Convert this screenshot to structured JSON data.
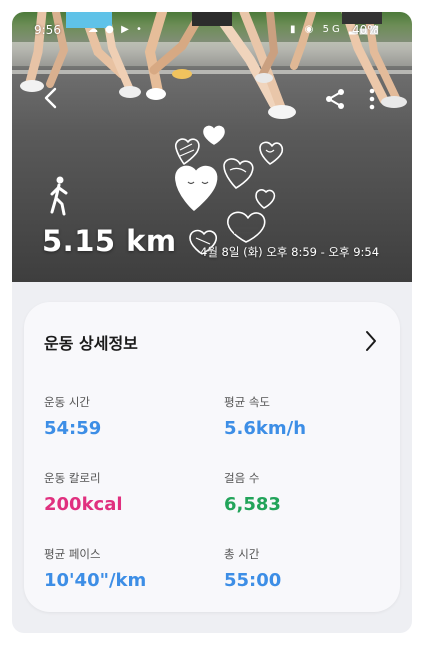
{
  "status_bar": {
    "time": "9:56",
    "left_icons": "☁ ● ▶ •",
    "right_icons": "▮ ◉ 5G ▂▄▆",
    "battery": "40%"
  },
  "header": {
    "distance": "5.15 km",
    "time_range": "4월 8일 (화) 오후 8:59 - 오후 9:54"
  },
  "detail": {
    "title": "운동 상세정보",
    "metrics": [
      {
        "label": "운동 시간",
        "value": "54:59",
        "color": "#3d8ee6"
      },
      {
        "label": "평균 속도",
        "value": "5.6km/h",
        "color": "#3d8ee6"
      },
      {
        "label": "운동 칼로리",
        "value": "200kcal",
        "color": "#e0307f"
      },
      {
        "label": "걸음 수",
        "value": "6,583",
        "color": "#22a45a"
      },
      {
        "label": "평균 페이스",
        "value": "10'40\"/km",
        "color": "#3d8ee6"
      },
      {
        "label": "총 시간",
        "value": "55:00",
        "color": "#3d8ee6"
      }
    ]
  },
  "icons": {
    "back": "chevron-left-icon",
    "share": "share-icon",
    "more": "more-vertical-icon",
    "activity": "walking-person-icon",
    "decoration": "hearts-doodle-icon",
    "detail_link": "chevron-right-icon"
  }
}
